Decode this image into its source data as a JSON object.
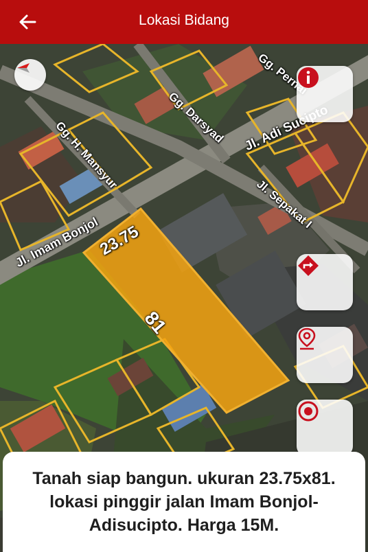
{
  "appbar": {
    "title": "Lokasi Bidang"
  },
  "map": {
    "streets": {
      "gg_pernai": "Gg. Pernai",
      "gg_darsyad": "Gg. Darsyad",
      "jl_adi_sucipto": "Jl. Adi Sucipto",
      "gg_h_mansyur": "Gg. H. Mansyur",
      "jl_sepakat": "Jl. Sepakat I",
      "jl_imam_bonjol": "Jl. Imam Bonjol"
    },
    "parcel": {
      "width_label": "23.75",
      "length_label": "81",
      "fill_color": "#f5a310"
    }
  },
  "description": "Tanah siap bangun. ukuran 23.75x81. lokasi pinggir jalan Imam Bonjol-Adisucipto. Harga 15M.",
  "colors": {
    "accent": "#b80d0d",
    "parcel": "#f5a310",
    "boundary": "#e7b52a"
  },
  "icons": [
    "back-arrow-icon",
    "compass-icon",
    "info-icon",
    "directions-icon",
    "location-pin-icon",
    "my-location-icon"
  ]
}
